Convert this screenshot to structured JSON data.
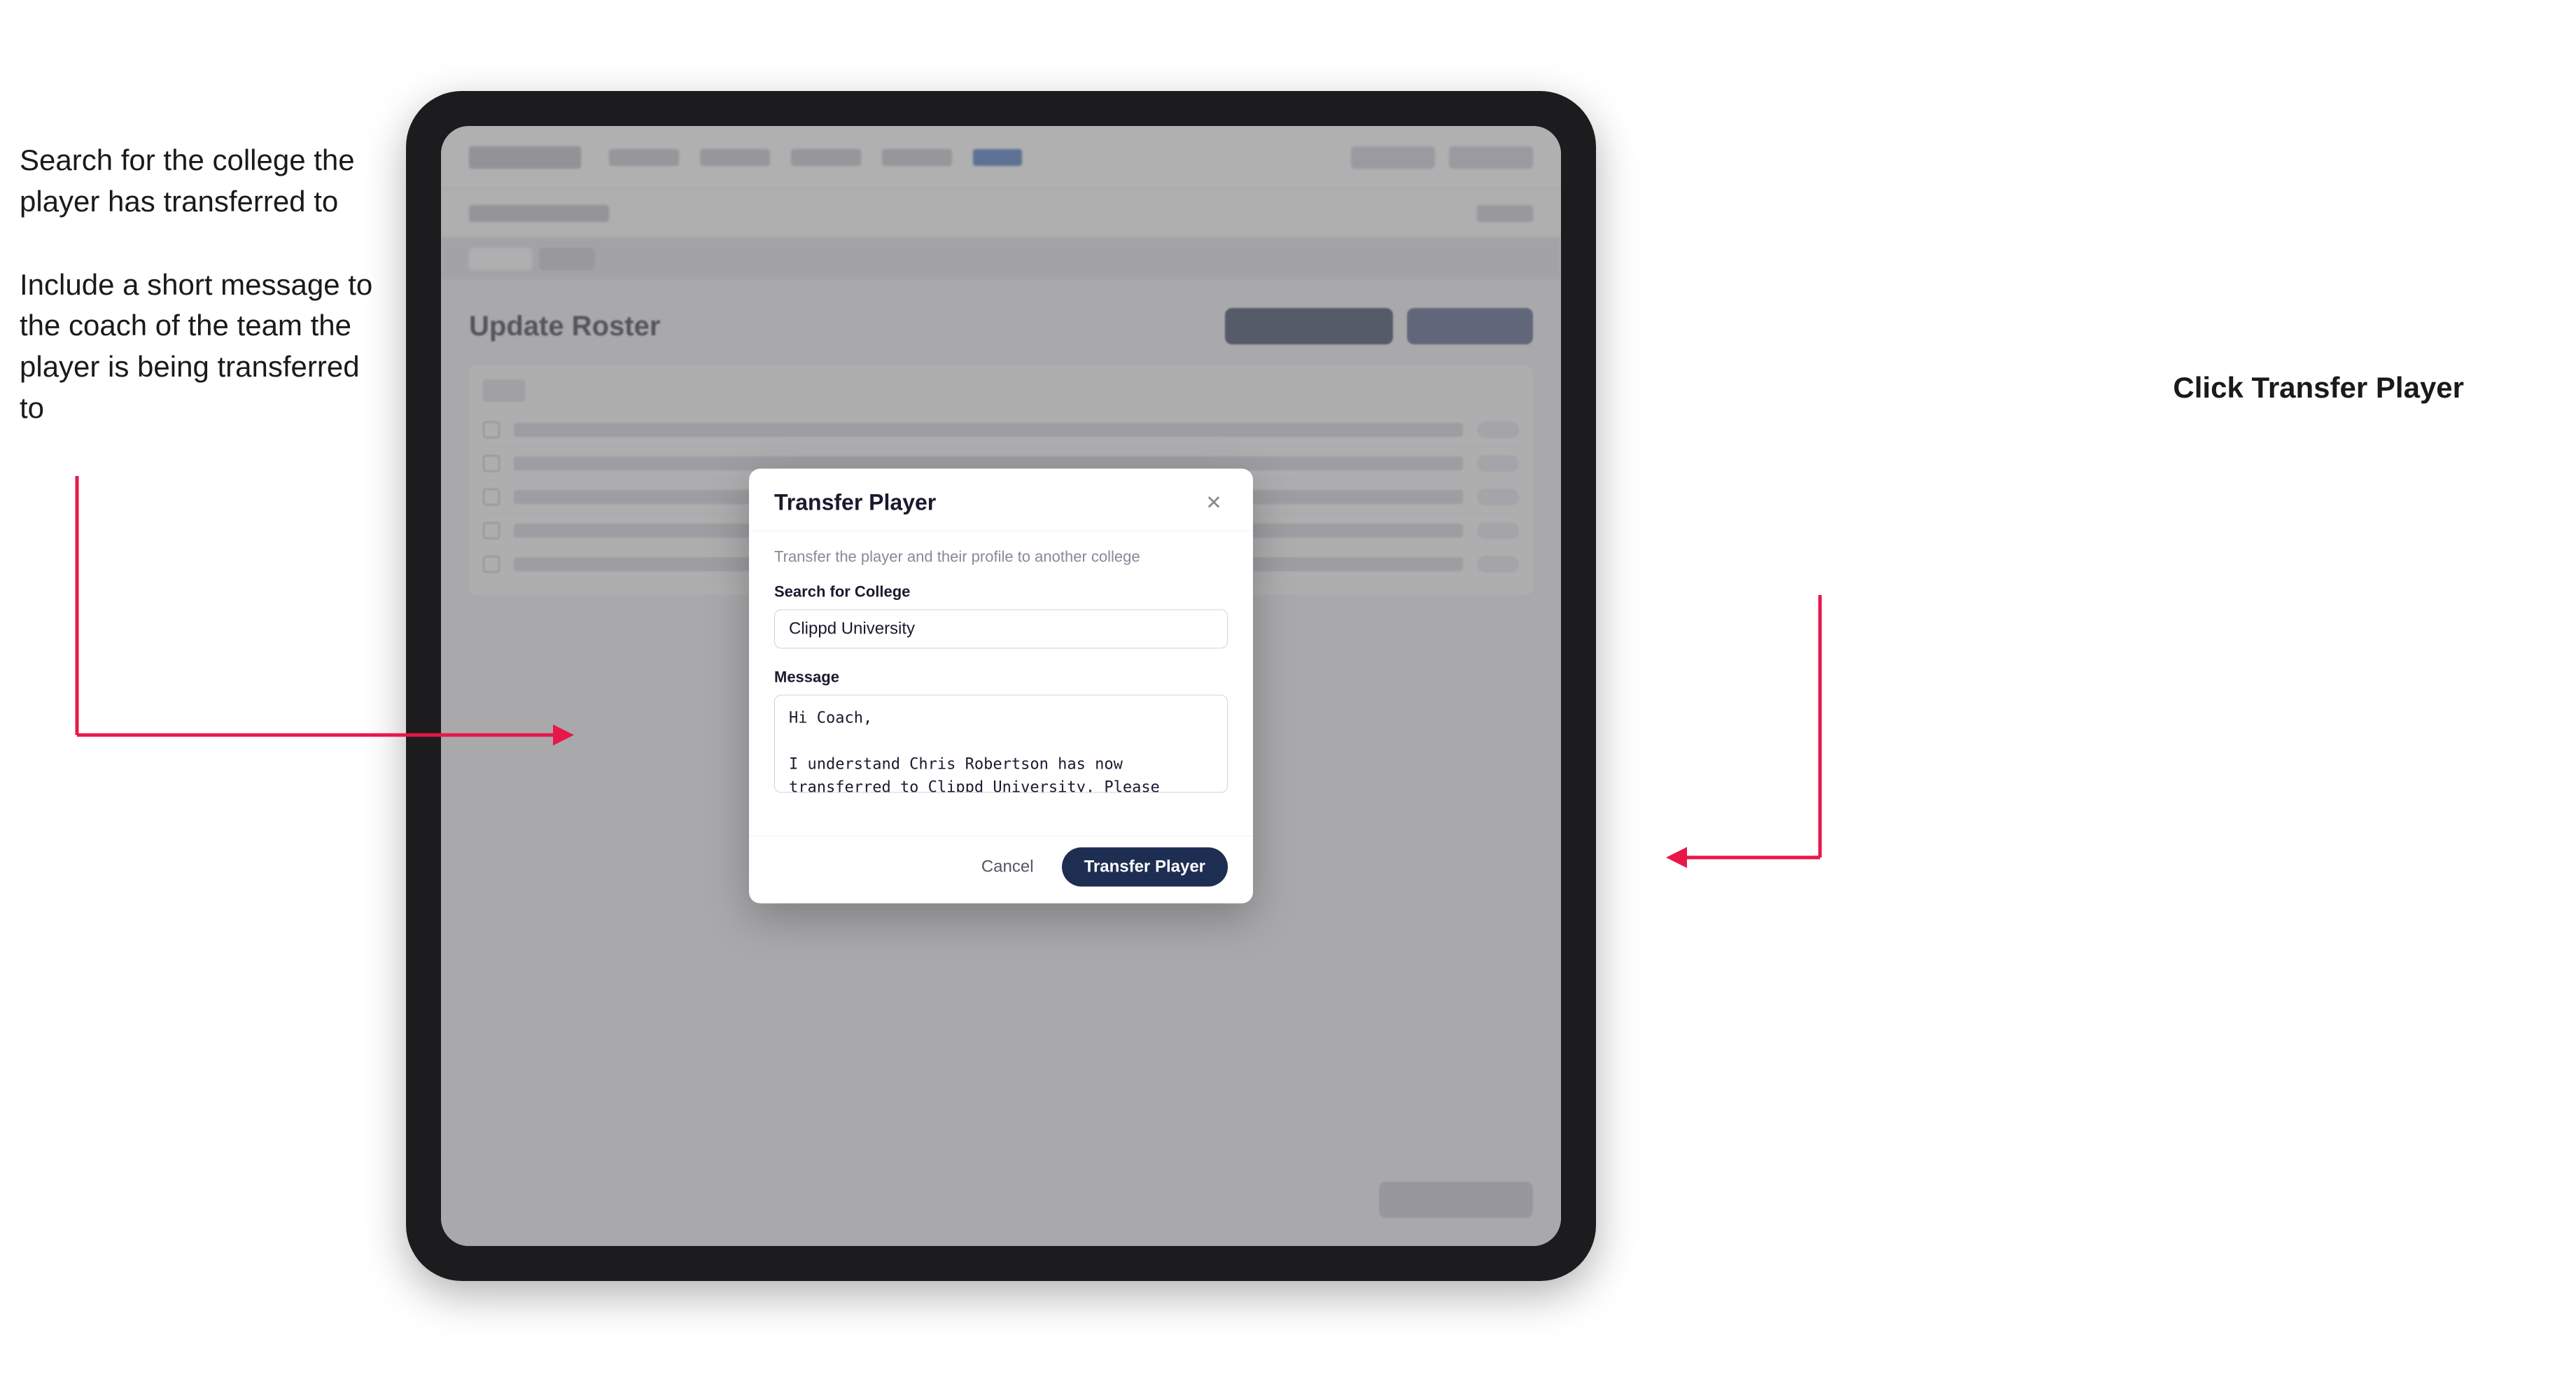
{
  "annotations": {
    "left_top": "Search for the college the player has transferred to",
    "left_bottom": "Include a short message to the coach of the team the player is being transferred to",
    "right": "Click ",
    "right_bold": "Transfer Player"
  },
  "tablet": {
    "page_title": "Update Roster"
  },
  "modal": {
    "title": "Transfer Player",
    "subtitle": "Transfer the player and their profile to another college",
    "search_label": "Search for College",
    "search_value": "Clippd University",
    "search_placeholder": "Search for College",
    "message_label": "Message",
    "message_value": "Hi Coach,\n\nI understand Chris Robertson has now transferred to Clippd University. Please accept this transfer request when you can.",
    "cancel_label": "Cancel",
    "transfer_label": "Transfer Player"
  }
}
